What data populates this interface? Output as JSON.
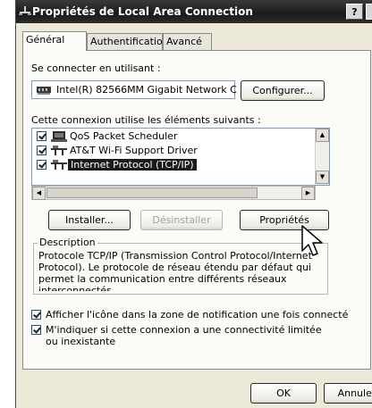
{
  "window": {
    "title": "Propriétés de Local Area Connection",
    "help_button": "?"
  },
  "tabs": [
    {
      "label": "Général",
      "active": true
    },
    {
      "label": "Authentification",
      "active": false
    },
    {
      "label": "Avancé",
      "active": false
    }
  ],
  "general": {
    "connect_using_label": "Se connecter en utilisant :",
    "adapter_name": "Intel(R) 82566MM Gigabit Network C",
    "configure_button": "Configurer...",
    "components_label": "Cette connexion utilise les éléments suivants :",
    "components": [
      {
        "label": "QoS Packet Scheduler",
        "checked": true,
        "icon": "scheduler-icon",
        "selected": false
      },
      {
        "label": "AT&T Wi-Fi Support Driver",
        "checked": true,
        "icon": "network-protocol-icon",
        "selected": false
      },
      {
        "label": "Internet Protocol (TCP/IP)",
        "checked": true,
        "icon": "network-protocol-icon",
        "selected": true
      }
    ],
    "install_button": "Installer...",
    "uninstall_button": "Désinstaller",
    "properties_button": "Propriétés",
    "description_title": "Description",
    "description_text": "Protocole TCP/IP (Transmission Control Protocol/Internet Protocol). Le protocole de réseau étendu par défaut qui permet la communication entre différents réseaux interconnectés.",
    "option_show_icon": "Afficher l'icône dans la zone de notification une fois connecté",
    "option_notify_limited": "M'indiquer si cette connexion a une connectivité limitée ou inexistante"
  },
  "footer": {
    "ok_button": "OK",
    "cancel_button": "Annuler"
  }
}
